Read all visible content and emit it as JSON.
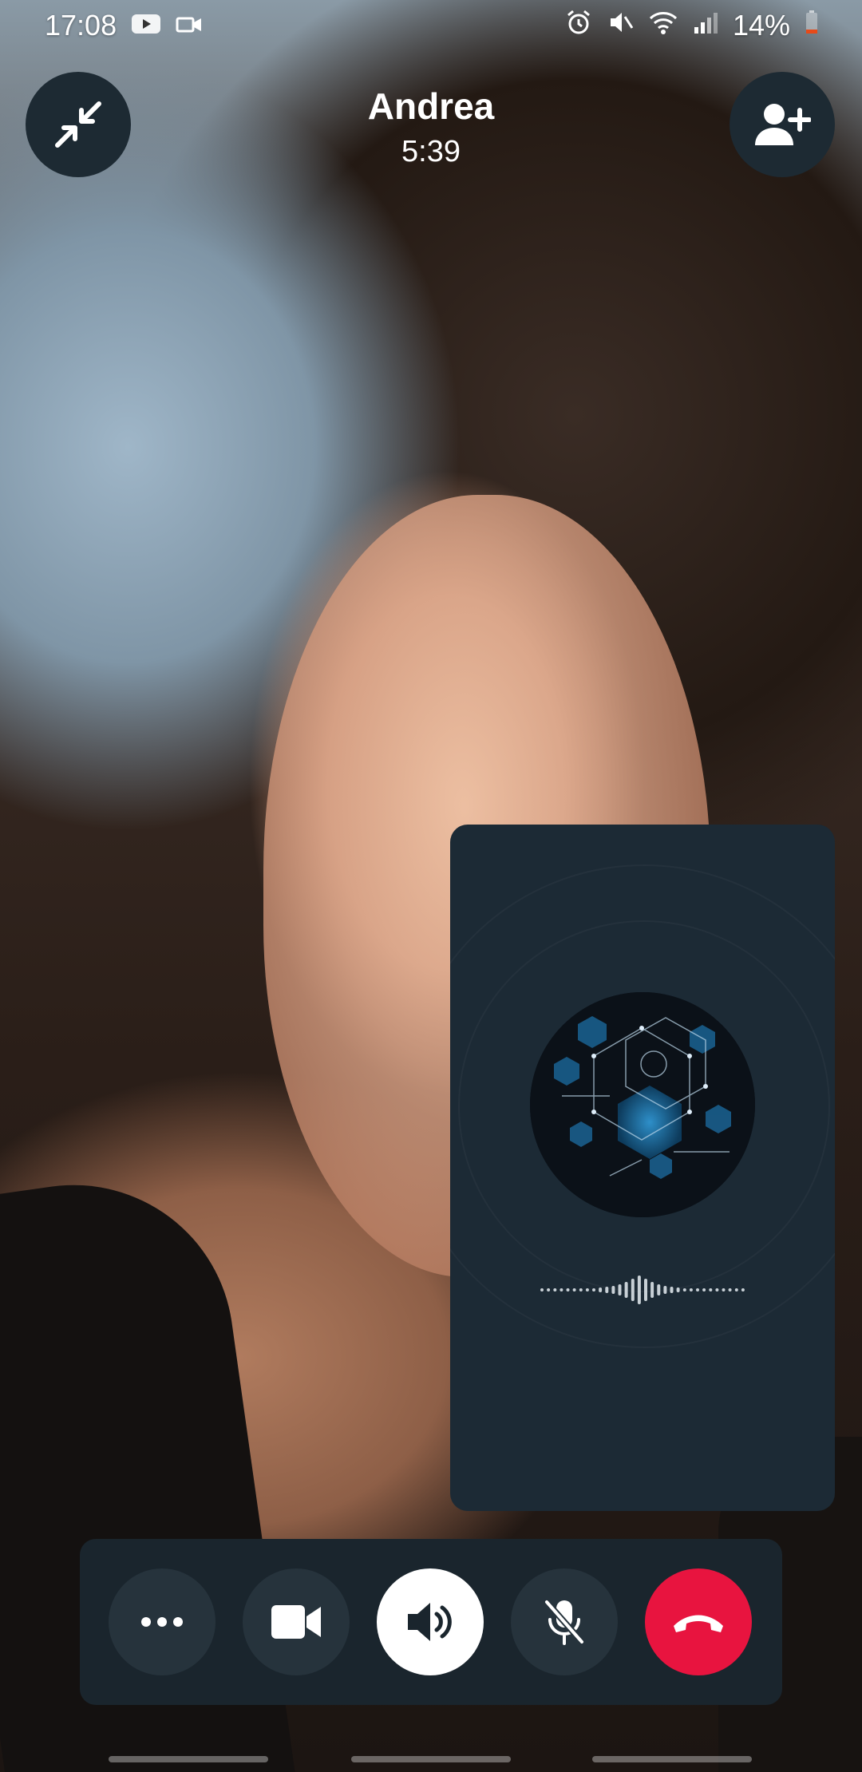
{
  "status_bar": {
    "time": "17:08",
    "battery": "14%",
    "left_icons": [
      "youtube-icon",
      "video-record-icon"
    ],
    "right_icons": [
      "alarm-icon",
      "mute-icon",
      "wifi-icon",
      "signal-icon",
      "battery-icon"
    ]
  },
  "call": {
    "contact_name": "Andrea",
    "duration": "5:39"
  },
  "header_buttons": {
    "minimize_icon": "minimize-arrows-icon",
    "add_participant_icon": "add-person-icon"
  },
  "controls": [
    {
      "name": "more-options-button",
      "icon": "ellipsis-icon"
    },
    {
      "name": "camera-button",
      "icon": "video-camera-icon"
    },
    {
      "name": "speaker-button",
      "icon": "speaker-icon"
    },
    {
      "name": "mute-button",
      "icon": "mic-off-icon"
    },
    {
      "name": "end-call-button",
      "icon": "hang-up-icon"
    }
  ],
  "colors": {
    "end_call": "#e8143f",
    "control_bg": "#26333c",
    "bar_bg": "#1a252d",
    "preview_bg": "#1c2a35"
  }
}
